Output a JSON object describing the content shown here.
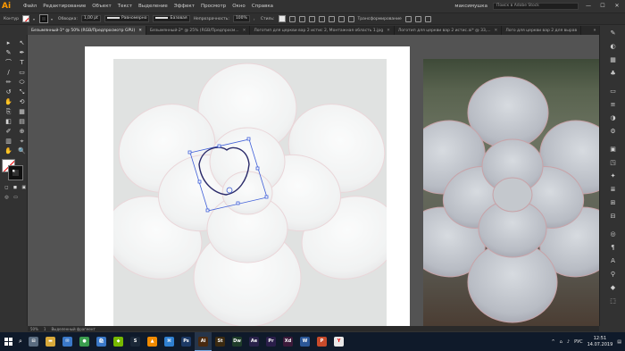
{
  "app": {
    "logo": "Ai"
  },
  "menu": [
    "Файл",
    "Редактирование",
    "Объект",
    "Текст",
    "Выделение",
    "Эффект",
    "Просмотр",
    "Окно",
    "Справка"
  ],
  "user": "максимушка",
  "search_placeholder": "Поиск в Adobe Stock",
  "window_controls": [
    "—",
    "☐",
    "✕"
  ],
  "control_bar": {
    "selection_label": "Контур",
    "stroke_label": "Обводка:",
    "stroke_width": "1,00 pt",
    "profile_label": "Равномерно",
    "brush_label": "Базовая",
    "opacity_label": "Непрозрачность:",
    "opacity_value": "100%",
    "style_label": "Стиль:",
    "transform_label": "Трансформирование"
  },
  "tabs": [
    {
      "label": "Безымянный-1* @ 50% (RGB/Предпросмотр GPU)",
      "active": true
    },
    {
      "label": "Безымянный-2* @ 25% (RGB/Предпросм...",
      "active": false
    },
    {
      "label": "Логотип для церкви вар 2 истис 2, Монтажная область 1.jpg",
      "active": false
    },
    {
      "label": "Логотип для церкви вар 2 истис.ai* @ 33,...",
      "active": false
    },
    {
      "label": "Лого для церкви вар 2 для вырав",
      "active": false
    }
  ],
  "tools": [
    "▸",
    "↖",
    "✎",
    "✒",
    "⌒",
    "T",
    "/",
    "▭",
    "✏",
    "⬭",
    "↺",
    "⤡",
    "✋",
    "⟲",
    "⎘",
    "▦",
    "◧",
    "▤",
    "✐",
    "⊕",
    "▥",
    "⌖",
    "✋",
    "🔍"
  ],
  "small_tools": [
    "◻",
    "◼",
    "▣"
  ],
  "right_panel_icons": [
    "✎",
    "◐",
    "▦",
    "♣",
    "▭",
    "≡",
    "◑",
    "⚙",
    "▣",
    "◳",
    "✦",
    "≣",
    "⊞",
    "⊟",
    "◎",
    "¶",
    "A",
    "⚲",
    "◆",
    "⬚"
  ],
  "status": {
    "zoom": "50%",
    "page": "1",
    "mode": "Выделенный фрагмент"
  },
  "taskbar": {
    "apps": [
      {
        "name": "task-view",
        "label": "⊟",
        "color": "#5a6c80"
      },
      {
        "name": "explorer",
        "label": "▬",
        "color": "#d8a93a"
      },
      {
        "name": "mail",
        "label": "✉",
        "color": "#3a78c8"
      },
      {
        "name": "chrome",
        "label": "●",
        "color": "#3a9d4e"
      },
      {
        "name": "store",
        "label": "🛍",
        "color": "#3a78c8"
      },
      {
        "name": "nvidia",
        "label": "◆",
        "color": "#76b900"
      },
      {
        "name": "steam",
        "label": "S",
        "color": "#1b2838"
      },
      {
        "name": "vlc",
        "label": "▲",
        "color": "#f08a00"
      },
      {
        "name": "vscode",
        "label": "⌘",
        "color": "#2f80d0"
      },
      {
        "name": "photoshop",
        "label": "Ps",
        "color": "#1d3a66"
      },
      {
        "name": "illustrator",
        "label": "Ai",
        "color": "#4a2a10"
      },
      {
        "name": "stock",
        "label": "St",
        "color": "#3b2a10"
      },
      {
        "name": "dreamweaver",
        "label": "Dw",
        "color": "#1f3d2a"
      },
      {
        "name": "after-effects",
        "label": "Ae",
        "color": "#29224a"
      },
      {
        "name": "premiere",
        "label": "Pr",
        "color": "#2a1e4a"
      },
      {
        "name": "xd",
        "label": "Xd",
        "color": "#3c1a3a"
      },
      {
        "name": "word",
        "label": "W",
        "color": "#2b5797"
      },
      {
        "name": "powerpoint",
        "label": "P",
        "color": "#c84b2b"
      },
      {
        "name": "yandex",
        "label": "Y",
        "color": "#e8e8e8"
      }
    ],
    "tray_expand": "^",
    "language": "РУС",
    "time": "12:51",
    "date": "14.07.2019"
  }
}
